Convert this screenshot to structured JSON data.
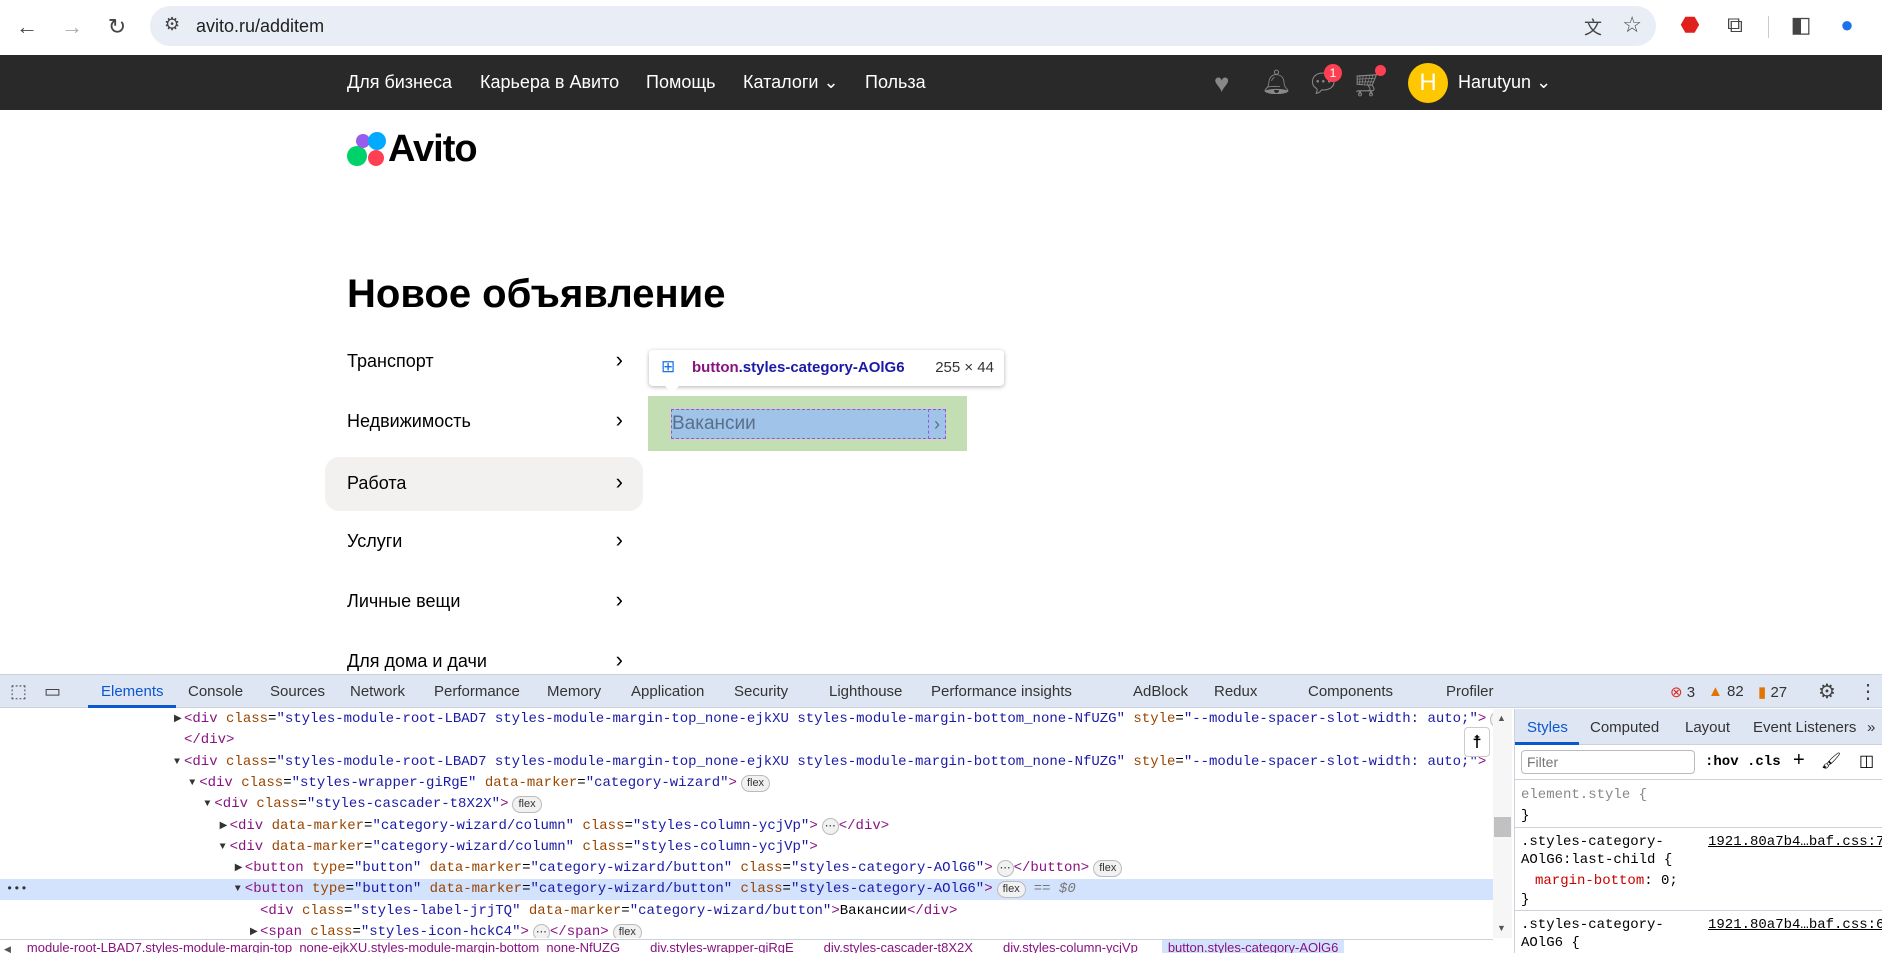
{
  "browser": {
    "url": "avito.ru/additem"
  },
  "topnav": {
    "links": [
      "Для бизнеса",
      "Карьера в Авито",
      "Помощь",
      "Каталоги",
      "Польза"
    ],
    "catalog_chevron": "⌄",
    "messages_badge": "1",
    "user_initial": "H",
    "user_name": "Harutyun"
  },
  "logo": "Avito",
  "page_title": "Новое объявление",
  "categories": [
    "Транспорт",
    "Недвижимость",
    "Работа",
    "Услуги",
    "Личные вещи",
    "Для дома и дачи"
  ],
  "selected_category": "Работа",
  "subcategory": "Вакансии",
  "inspect_tooltip": {
    "tag": "button",
    "cls": ".styles-category-AOlG6",
    "size": "255 × 44"
  },
  "devtools": {
    "tabs": [
      "Elements",
      "Console",
      "Sources",
      "Network",
      "Performance",
      "Memory",
      "Application",
      "Security",
      "Lighthouse",
      "Performance insights",
      "AdBlock",
      "Redux",
      "Components",
      "Profiler"
    ],
    "active_tab": "Elements",
    "errors": "3",
    "warnings": "82",
    "issues": "27",
    "dom_lines": [
      {
        "indent": 0,
        "tri": "▶",
        "tokens": [
          [
            "t",
            "<div"
          ],
          [
            "n",
            " class"
          ],
          [
            "x",
            "="
          ],
          [
            "v",
            "\"styles-module-root-LBAD7 styles-module-margin-top_none-ejkXU styles-module-margin-bottom_none-NfUZG\""
          ],
          [
            "n",
            " style"
          ],
          [
            "x",
            "="
          ],
          [
            "v",
            "\"--module-spacer-slot-width: auto;\""
          ],
          [
            "t",
            ">"
          ]
        ],
        "dots": true
      },
      {
        "indent": 0,
        "tokens": [
          [
            "t",
            "</div>"
          ]
        ]
      },
      {
        "indent": 0,
        "tri": "▼",
        "tokens": [
          [
            "t",
            "<div"
          ],
          [
            "n",
            " class"
          ],
          [
            "x",
            "="
          ],
          [
            "v",
            "\"styles-module-root-LBAD7 styles-module-margin-top_none-ejkXU styles-module-margin-bottom_none-NfUZG\""
          ],
          [
            "n",
            " style"
          ],
          [
            "x",
            "="
          ],
          [
            "v",
            "\"--module-spacer-slot-width: auto;\""
          ],
          [
            "t",
            ">"
          ]
        ]
      },
      {
        "indent": 1,
        "tri": "▼",
        "tokens": [
          [
            "t",
            "<div"
          ],
          [
            "n",
            " class"
          ],
          [
            "x",
            "="
          ],
          [
            "v",
            "\"styles-wrapper-giRgE\""
          ],
          [
            "n",
            " data-marker"
          ],
          [
            "x",
            "="
          ],
          [
            "v",
            "\"category-wizard\""
          ],
          [
            "t",
            ">"
          ]
        ],
        "pill": "flex"
      },
      {
        "indent": 2,
        "tri": "▼",
        "tokens": [
          [
            "t",
            "<div"
          ],
          [
            "n",
            " class"
          ],
          [
            "x",
            "="
          ],
          [
            "v",
            "\"styles-cascader-t8X2X\""
          ],
          [
            "t",
            ">"
          ]
        ],
        "pill": "flex"
      },
      {
        "indent": 3,
        "tri": "▶",
        "tokens": [
          [
            "t",
            "<div"
          ],
          [
            "n",
            " data-marker"
          ],
          [
            "x",
            "="
          ],
          [
            "v",
            "\"category-wizard/column\""
          ],
          [
            "n",
            " class"
          ],
          [
            "x",
            "="
          ],
          [
            "v",
            "\"styles-column-ycjVp\""
          ],
          [
            "t",
            ">"
          ]
        ],
        "dots": true,
        "close": "</div>"
      },
      {
        "indent": 3,
        "tri": "▼",
        "tokens": [
          [
            "t",
            "<div"
          ],
          [
            "n",
            " data-marker"
          ],
          [
            "x",
            "="
          ],
          [
            "v",
            "\"category-wizard/column\""
          ],
          [
            "n",
            " class"
          ],
          [
            "x",
            "="
          ],
          [
            "v",
            "\"styles-column-ycjVp\""
          ],
          [
            "t",
            ">"
          ]
        ]
      },
      {
        "indent": 4,
        "tri": "▶",
        "tokens": [
          [
            "t",
            "<button"
          ],
          [
            "n",
            " type"
          ],
          [
            "x",
            "="
          ],
          [
            "v",
            "\"button\""
          ],
          [
            "n",
            " data-marker"
          ],
          [
            "x",
            "="
          ],
          [
            "v",
            "\"category-wizard/button\""
          ],
          [
            "n",
            " class"
          ],
          [
            "x",
            "="
          ],
          [
            "v",
            "\"styles-category-AOlG6\""
          ],
          [
            "t",
            ">"
          ]
        ],
        "dots": true,
        "close": "</button>",
        "pill": "flex"
      },
      {
        "indent": 4,
        "tri": "▼",
        "sel": true,
        "tokens": [
          [
            "t",
            "<button"
          ],
          [
            "n",
            " type"
          ],
          [
            "x",
            "="
          ],
          [
            "v",
            "\"button\""
          ],
          [
            "n",
            " data-marker"
          ],
          [
            "x",
            "="
          ],
          [
            "v",
            "\"category-wizard/button\""
          ],
          [
            "n",
            " class"
          ],
          [
            "x",
            "="
          ],
          [
            "v",
            "\"styles-category-AOlG6\""
          ],
          [
            "t",
            ">"
          ]
        ],
        "pill": "flex",
        "dollar": "== $0"
      },
      {
        "indent": 5,
        "tokens": [
          [
            "t",
            "<div"
          ],
          [
            "n",
            " class"
          ],
          [
            "x",
            "="
          ],
          [
            "v",
            "\"styles-label-jrjTQ\""
          ],
          [
            "n",
            " data-marker"
          ],
          [
            "x",
            "="
          ],
          [
            "v",
            "\"category-wizard/button\""
          ],
          [
            "t",
            ">"
          ],
          [
            "x",
            "Вакансии"
          ],
          [
            "t",
            "</div>"
          ]
        ]
      },
      {
        "indent": 5,
        "tri": "▶",
        "tokens": [
          [
            "t",
            "<span"
          ],
          [
            "n",
            " class"
          ],
          [
            "x",
            "="
          ],
          [
            "v",
            "\"styles-icon-hckC4\""
          ],
          [
            "t",
            ">"
          ]
        ],
        "dots": true,
        "close": "</span>",
        "pill": "flex"
      }
    ],
    "breadcrumbs": [
      "module-root-LBAD7.styles-module-margin-top_none-ejkXU.styles-module-margin-bottom_none-NfUZG",
      "div.styles-wrapper-giRgE",
      "div.styles-cascader-t8X2X",
      "div.styles-column-ycjVp",
      "button.styles-category-AOlG6"
    ],
    "styles_tabs": [
      "Styles",
      "Computed",
      "Layout",
      "Event Listeners",
      "»"
    ],
    "filter_placeholder": "Filter",
    "hov": ":hov",
    "cls": ".cls",
    "element_style": "element.style {",
    "close_brace": "}",
    "rule1": {
      "selector1": ".styles-category-",
      "selector2": "AOlG6:last-child {",
      "source": "1921.80a7b4…baf.css:7",
      "prop": "margin-bottom",
      "val": "0;"
    },
    "rule2": {
      "selector1": ".styles-category-",
      "selector2": "AOlG6 {",
      "source": "1921.80a7b4…baf.css:6"
    }
  }
}
